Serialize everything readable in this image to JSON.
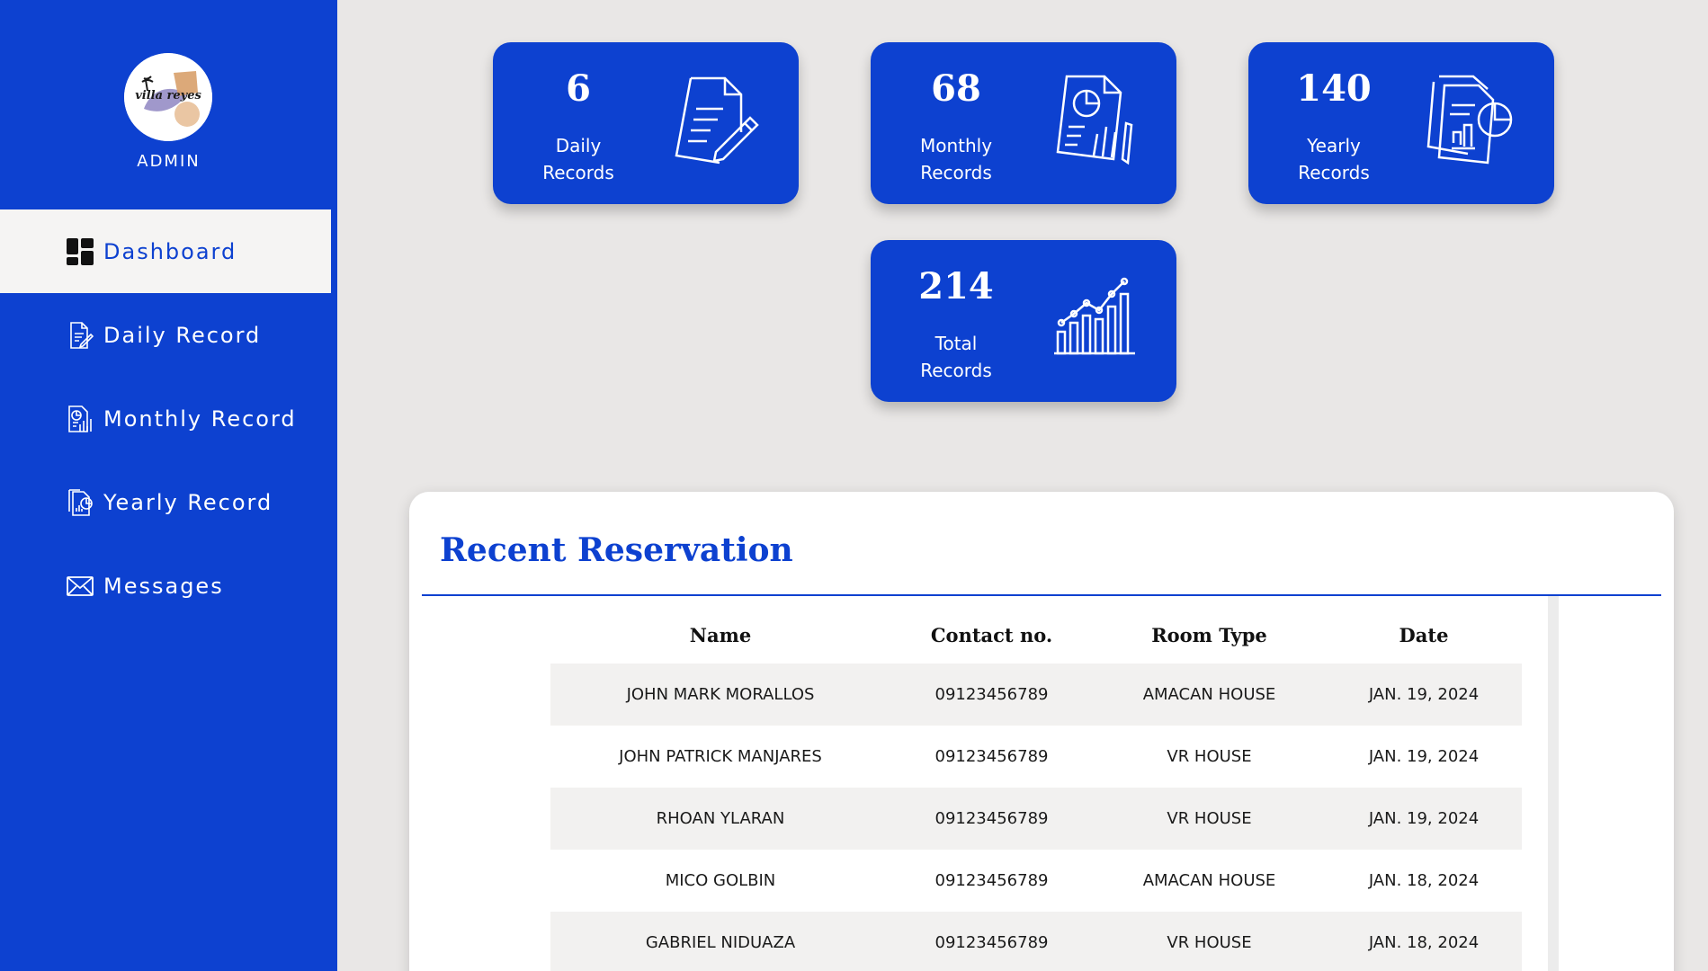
{
  "sidebar": {
    "logo_text": "villa reyes",
    "role_label": "ADMIN",
    "items": [
      {
        "label": "Dashboard",
        "icon": "dashboard-grid-icon",
        "active": true
      },
      {
        "label": "Daily Record",
        "icon": "document-edit-icon",
        "active": false
      },
      {
        "label": "Monthly Record",
        "icon": "report-chart-icon",
        "active": false
      },
      {
        "label": "Yearly Record",
        "icon": "documents-pie-icon",
        "active": false
      },
      {
        "label": "Messages",
        "icon": "envelope-icon",
        "active": false
      }
    ]
  },
  "stats": [
    {
      "count": "6",
      "label_line1": "Daily",
      "label_line2": "Records",
      "icon": "document-edit-icon"
    },
    {
      "count": "68",
      "label_line1": "Monthly",
      "label_line2": "Records",
      "icon": "report-chart-icon"
    },
    {
      "count": "140",
      "label_line1": "Yearly",
      "label_line2": "Records",
      "icon": "documents-pie-icon"
    },
    {
      "count": "214",
      "label_line1": "Total",
      "label_line2": "Records",
      "icon": "bar-line-chart-icon"
    }
  ],
  "reservations": {
    "title": "Recent Reservation",
    "columns": [
      "Name",
      "Contact no.",
      "Room Type",
      "Date"
    ],
    "rows": [
      {
        "name": "JOHN MARK MORALLOS",
        "contact": "09123456789",
        "room": "AMACAN HOUSE",
        "date": "JAN. 19, 2024"
      },
      {
        "name": "JOHN PATRICK MANJARES",
        "contact": "09123456789",
        "room": "VR HOUSE",
        "date": "JAN. 19, 2024"
      },
      {
        "name": "RHOAN YLARAN",
        "contact": "09123456789",
        "room": "VR HOUSE",
        "date": "JAN. 19, 2024"
      },
      {
        "name": "MICO GOLBIN",
        "contact": "09123456789",
        "room": "AMACAN HOUSE",
        "date": "JAN. 18, 2024"
      },
      {
        "name": "GABRIEL NIDUAZA",
        "contact": "09123456789",
        "room": "VR HOUSE",
        "date": "JAN. 18, 2024"
      }
    ]
  },
  "colors": {
    "accent": "#0d41d0",
    "background": "#e9e7e6",
    "row_shade": "#f2f1f0"
  }
}
